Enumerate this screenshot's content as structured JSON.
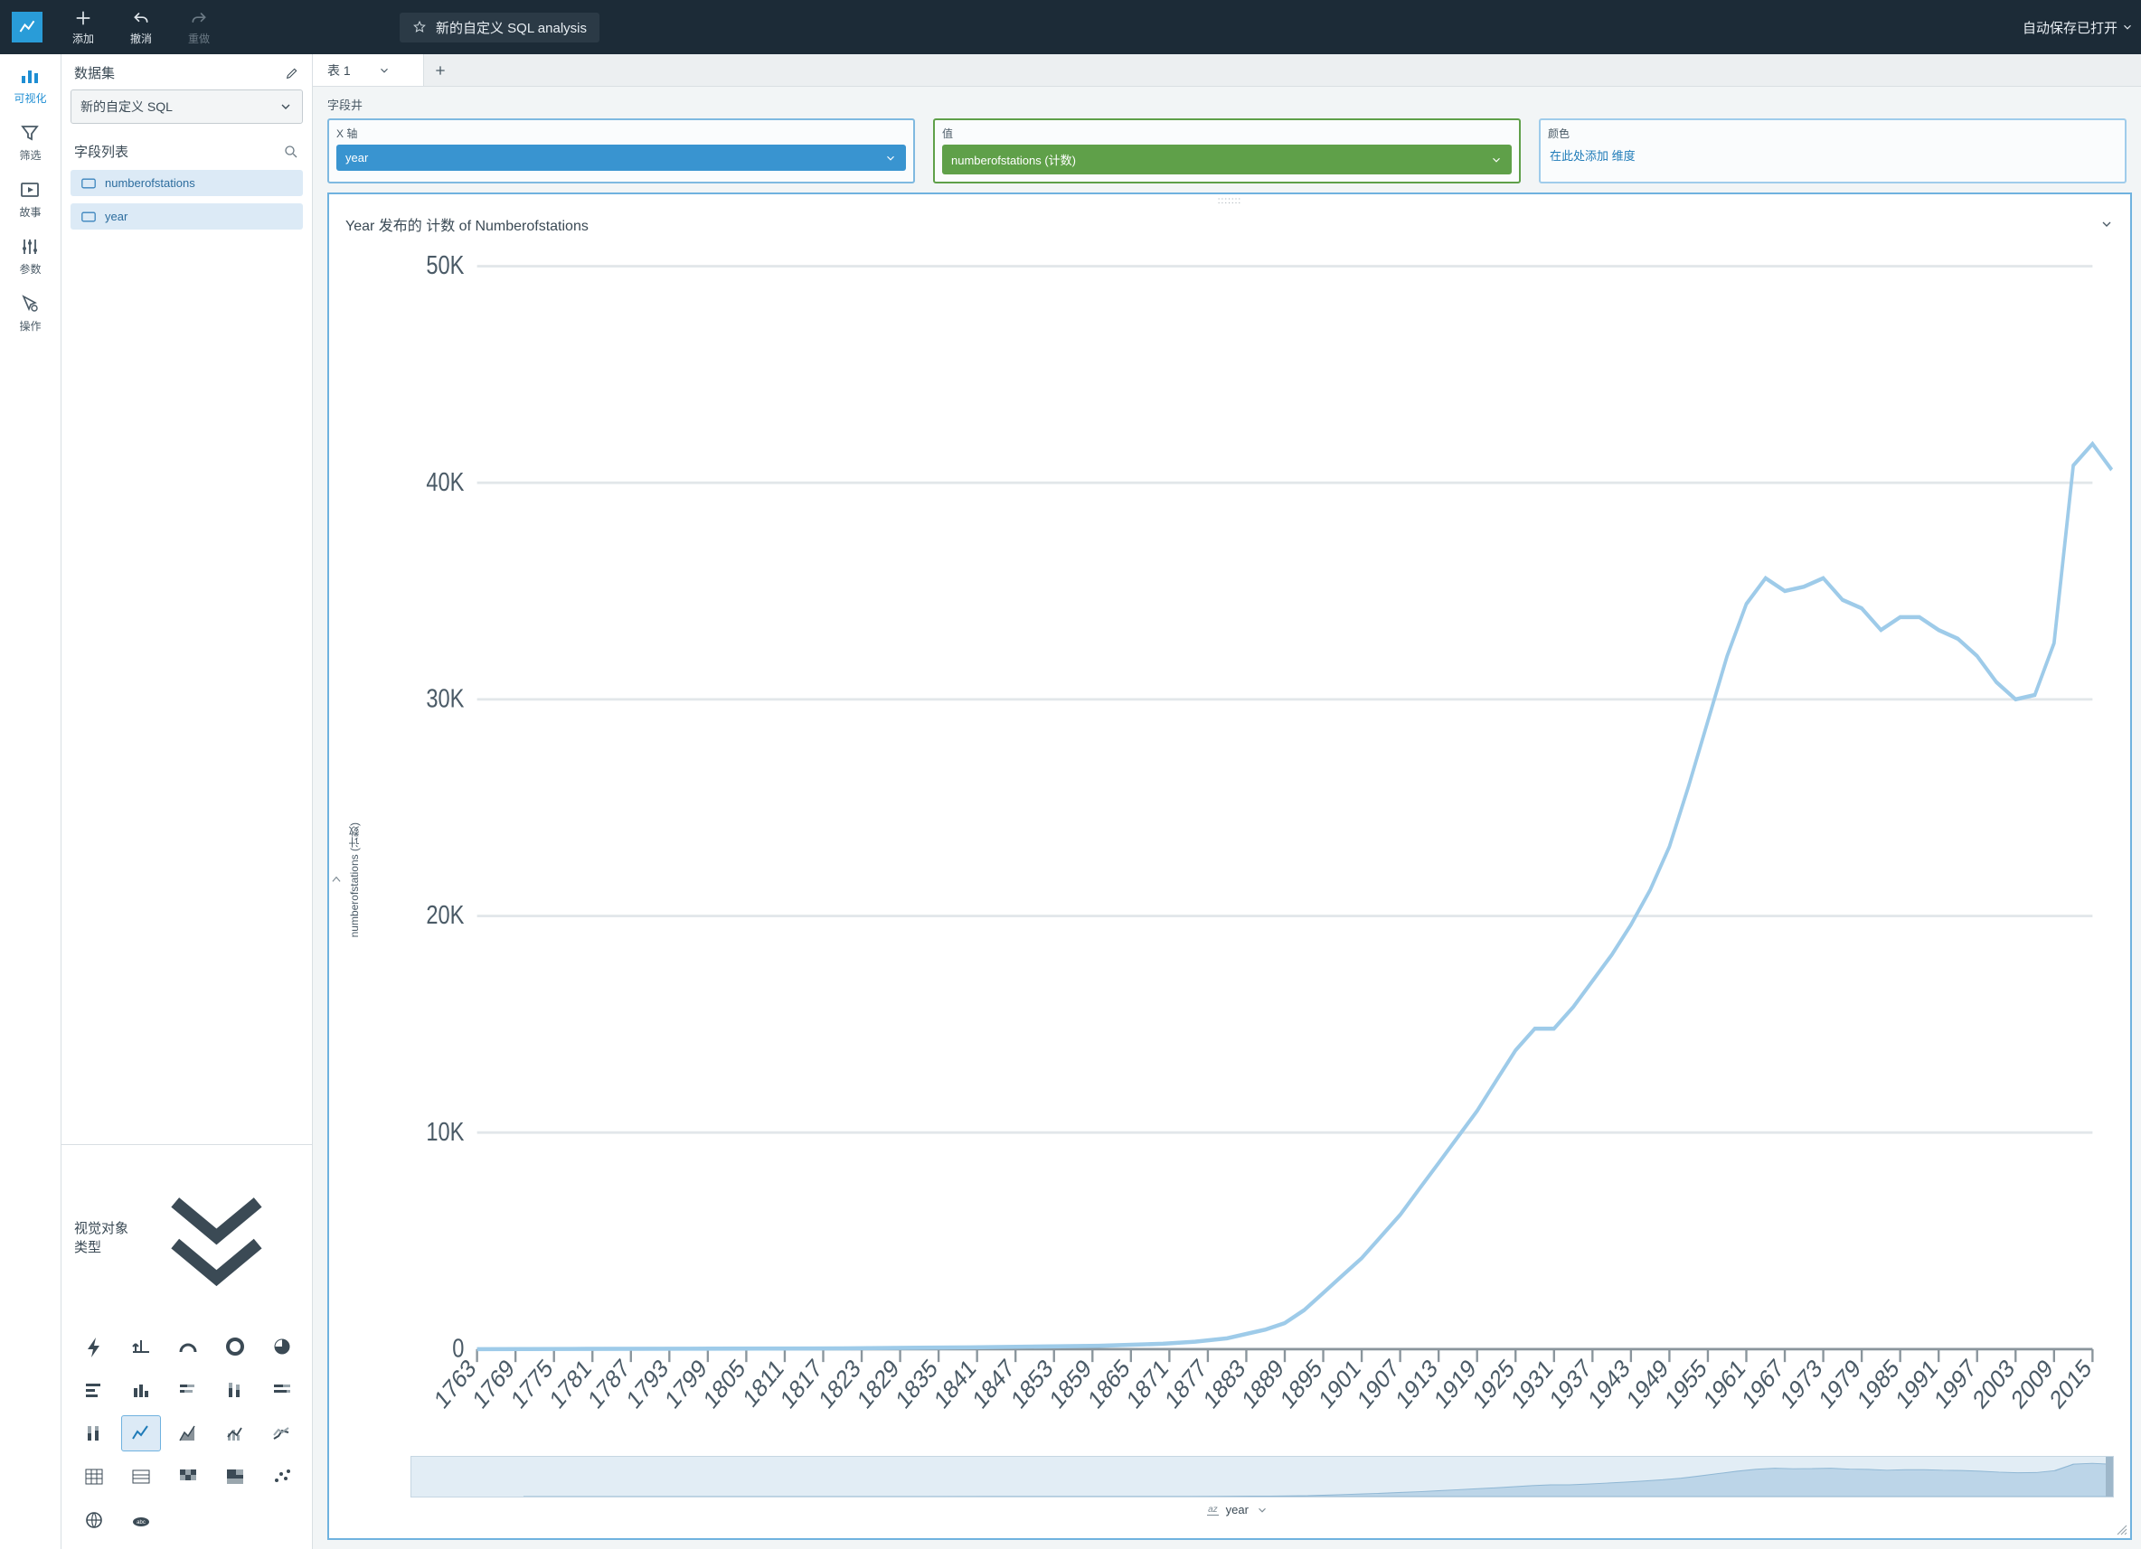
{
  "topbar": {
    "add_label": "添加",
    "undo_label": "撤消",
    "redo_label": "重做",
    "doc_title": "新的自定义 SQL analysis",
    "autosave_label": "自动保存已打开"
  },
  "rail": {
    "visualize": "可视化",
    "filter": "筛选",
    "story": "故事",
    "param": "参数",
    "action": "操作"
  },
  "datapanel": {
    "dataset_heading": "数据集",
    "dataset_selected": "新的自定义 SQL",
    "fields_heading": "字段列表",
    "fields": [
      {
        "name": "numberofstations"
      },
      {
        "name": "year"
      }
    ],
    "viz_types_heading": "视觉对象类型"
  },
  "tabs": {
    "tab1": "表 1"
  },
  "wells": {
    "section_label": "字段井",
    "x_label": "X 轴",
    "x_value": "year",
    "value_label": "值",
    "value_value": "numberofstations (计数)",
    "color_label": "颜色",
    "color_placeholder": "在此处添加 维度"
  },
  "chart": {
    "title": "Year 发布的 计数 of Numberofstations",
    "ylabel": "numberofstations (计数)",
    "xlabel": "year"
  },
  "chart_data": {
    "type": "line",
    "xlabel": "year",
    "ylabel": "numberofstations (计数)",
    "ylim": [
      0,
      50000
    ],
    "yticks": [
      0,
      10000,
      20000,
      30000,
      40000,
      50000
    ],
    "ytick_labels": [
      "0",
      "10K",
      "20K",
      "30K",
      "40K",
      "50K"
    ],
    "xticks": [
      1763,
      1769,
      1775,
      1781,
      1787,
      1793,
      1799,
      1805,
      1811,
      1817,
      1823,
      1829,
      1835,
      1841,
      1847,
      1853,
      1859,
      1865,
      1871,
      1877,
      1883,
      1889,
      1895,
      1901,
      1907,
      1913,
      1919,
      1925,
      1931,
      1937,
      1943,
      1949,
      1955,
      1961,
      1967,
      1973,
      1979,
      1985,
      1991,
      1997,
      2003,
      2009,
      2015
    ],
    "series": [
      {
        "name": "numberofstations (计数)",
        "x": [
          1763,
          1780,
          1800,
          1820,
          1840,
          1860,
          1870,
          1875,
          1880,
          1883,
          1886,
          1889,
          1892,
          1895,
          1898,
          1901,
          1904,
          1907,
          1910,
          1913,
          1916,
          1919,
          1922,
          1925,
          1928,
          1931,
          1934,
          1937,
          1940,
          1943,
          1946,
          1949,
          1952,
          1955,
          1958,
          1961,
          1964,
          1967,
          1970,
          1973,
          1976,
          1979,
          1982,
          1985,
          1988,
          1991,
          1994,
          1997,
          2000,
          2003,
          2006,
          2009,
          2012,
          2015,
          2018
        ],
        "y": [
          5,
          10,
          20,
          40,
          80,
          150,
          250,
          350,
          500,
          700,
          900,
          1200,
          1800,
          2600,
          3400,
          4200,
          5200,
          6200,
          7400,
          8600,
          9800,
          11000,
          12400,
          13800,
          14800,
          14800,
          15800,
          17000,
          18200,
          19600,
          21200,
          23200,
          26000,
          29000,
          32000,
          34400,
          35600,
          35000,
          35200,
          35600,
          34600,
          34200,
          33200,
          33800,
          33800,
          33200,
          32800,
          32000,
          30800,
          30000,
          30200,
          32600,
          40800,
          41800,
          40600
        ]
      }
    ]
  }
}
